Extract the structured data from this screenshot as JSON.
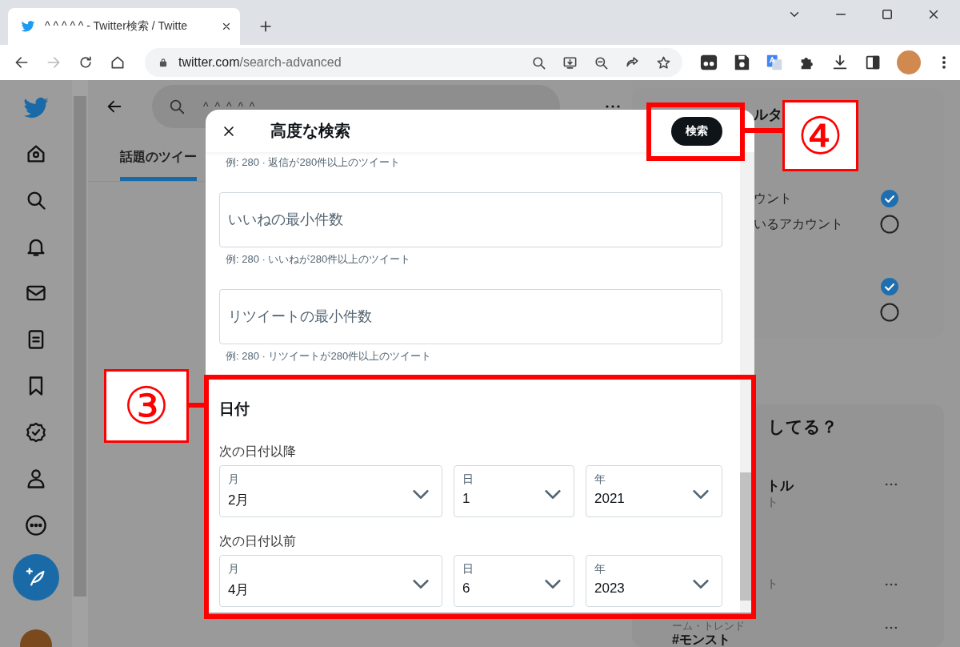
{
  "browser": {
    "tab": {
      "title": "^ ^ ^ ^ ^ - Twitter検索 / Twitte",
      "selected": true
    },
    "address": {
      "host": "twitter.com",
      "path": "/search-advanced"
    },
    "forward_disabled": true
  },
  "main": {
    "search": {
      "value": "^ ^ ^ ^ ^"
    },
    "tabs": [
      {
        "label": "話題のツイー",
        "selected": true
      }
    ]
  },
  "right": {
    "heading": "ルタ",
    "filter_groups": [
      {
        "options": [
          {
            "label": "ウント",
            "checked": true
          },
          {
            "label": "いるアカウント",
            "checked": false
          }
        ]
      },
      {
        "options": [
          {
            "checked": true
          },
          {
            "checked": false
          }
        ]
      }
    ],
    "trends": {
      "heading": "してる？",
      "items": [
        {
          "name": "トル",
          "meta": "ト"
        },
        {
          "meta": "ト"
        },
        {
          "context": "ーム・トレンド",
          "name": "#モンスト"
        }
      ]
    }
  },
  "dialog": {
    "title": "高度な検索",
    "submit": "検索",
    "top_hint": "例: 280 · 返信が280件以上のツイート",
    "fields": [
      {
        "placeholder": "いいねの最小件数",
        "hint": "例: 280 · いいねが280件以上のツイート"
      },
      {
        "placeholder": "リツイートの最小件数",
        "hint": "例: 280 · リツイートが280件以上のツイート"
      }
    ],
    "date": {
      "heading": "日付",
      "ranges": [
        {
          "label": "次の日付以降",
          "selects": [
            {
              "label": "月",
              "value": "2月"
            },
            {
              "label": "日",
              "value": "1"
            },
            {
              "label": "年",
              "value": "2021"
            }
          ]
        },
        {
          "label": "次の日付以前",
          "selects": [
            {
              "label": "月",
              "value": "4月"
            },
            {
              "label": "日",
              "value": "6"
            },
            {
              "label": "年",
              "value": "2023"
            }
          ]
        }
      ]
    }
  },
  "annotations": [
    {
      "label": "③"
    },
    {
      "label": "④"
    }
  ]
}
